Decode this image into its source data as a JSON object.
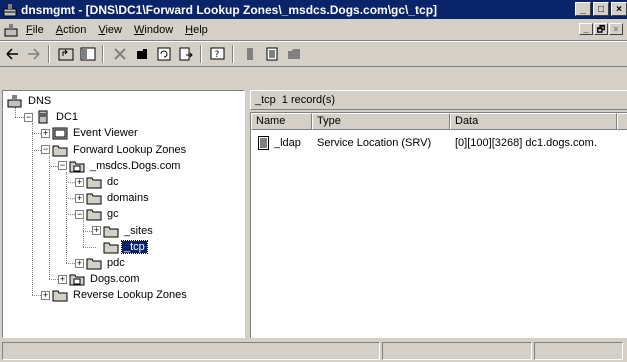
{
  "window": {
    "title": "dnsmgmt - [DNS\\DC1\\Forward Lookup Zones\\_msdcs.Dogs.com\\gc\\_tcp]",
    "buttons": [
      "_",
      "□",
      "×"
    ]
  },
  "menubar": {
    "items": [
      {
        "underline": "F",
        "rest": "ile"
      },
      {
        "underline": "A",
        "rest": "ction"
      },
      {
        "underline": "V",
        "rest": "iew"
      },
      {
        "underline": "W",
        "rest": "indow"
      },
      {
        "underline": "H",
        "rest": "elp"
      }
    ],
    "mdi_buttons": [
      "_",
      "🗗",
      "×"
    ]
  },
  "toolbar": {
    "icons": [
      "back-icon",
      "forward-icon",
      "up-one-level-icon",
      "show-hide-console-tree-icon",
      "delete-icon",
      "properties-icon",
      "refresh-icon",
      "export-list-icon",
      "help-icon",
      "server-icon",
      "text-record-icon",
      "folder-icon"
    ]
  },
  "tree": {
    "items": [
      {
        "label": "DNS",
        "icon": "dns-icon",
        "expander": ""
      },
      {
        "label": "DC1",
        "icon": "server-icon",
        "expander": "−"
      },
      {
        "label": "Event Viewer",
        "icon": "event-viewer-icon",
        "expander": "+"
      },
      {
        "label": "Forward Lookup Zones",
        "icon": "folder-icon",
        "expander": "−"
      },
      {
        "label": "_msdcs.Dogs.com",
        "icon": "zone-icon",
        "expander": "−"
      },
      {
        "label": "dc",
        "icon": "folder-icon",
        "expander": "+"
      },
      {
        "label": "domains",
        "icon": "folder-icon",
        "expander": "+"
      },
      {
        "label": "gc",
        "icon": "folder-icon",
        "expander": "−"
      },
      {
        "label": "_sites",
        "icon": "folder-icon",
        "expander": "+"
      },
      {
        "label": "_tcp",
        "icon": "folder-icon",
        "expander": "",
        "selected": true
      },
      {
        "label": "pdc",
        "icon": "folder-icon",
        "expander": "+"
      },
      {
        "label": "Dogs.com",
        "icon": "zone-icon",
        "expander": "+"
      },
      {
        "label": "Reverse Lookup Zones",
        "icon": "folder-icon",
        "expander": "+"
      }
    ]
  },
  "details": {
    "header_title": "_tcp",
    "header_count": "1 record(s)",
    "columns": [
      "Name",
      "Type",
      "Data"
    ],
    "rows": [
      {
        "name": "_ldap",
        "type": "Service Location (SRV)",
        "data": "[0][100][3268] dc1.dogs.com."
      }
    ]
  },
  "colors": {
    "titlebar": "#0a246a",
    "face": "#d4d0c8",
    "selection": "#0a246a"
  }
}
